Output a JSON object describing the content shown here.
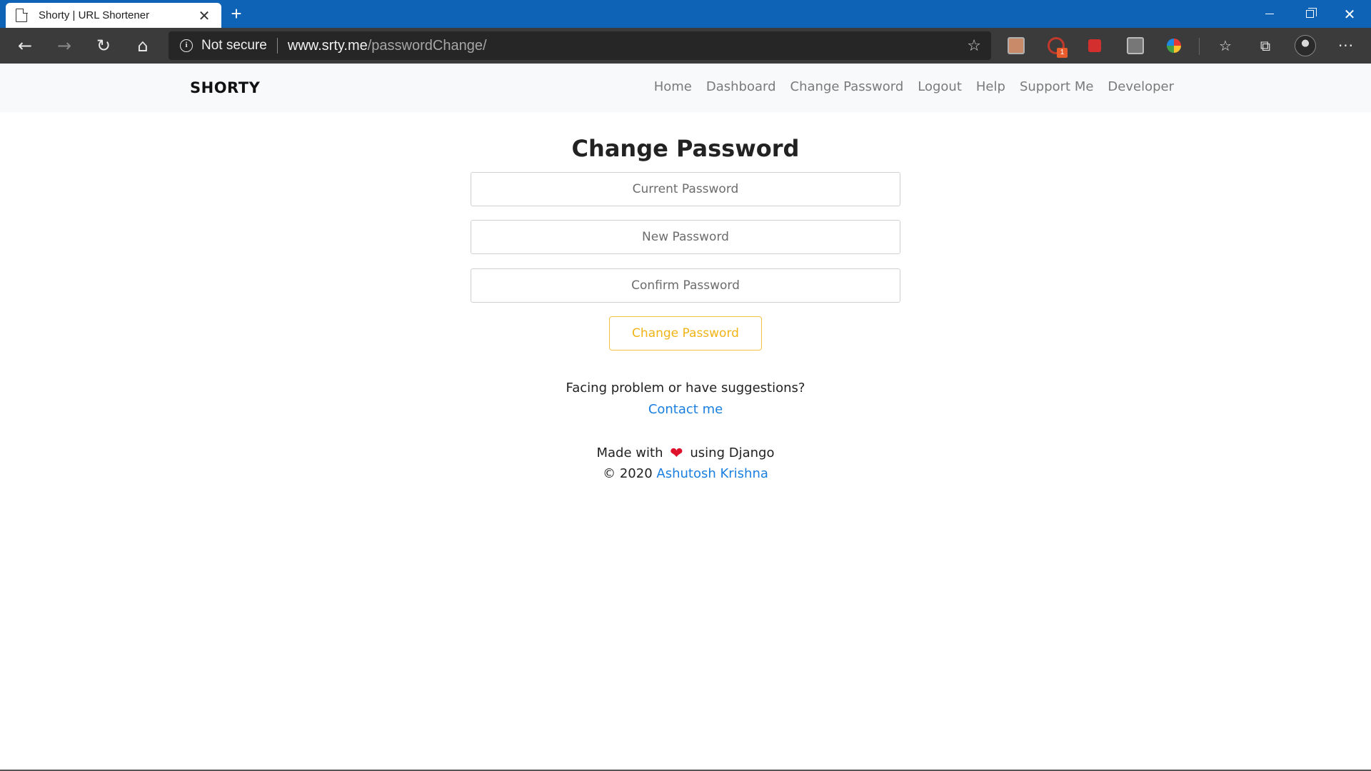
{
  "browser": {
    "tab_title": "Shorty | URL Shortener",
    "tab_close": "✕",
    "new_tab": "+",
    "security_label": "Not secure",
    "url_host": "www.srty.me",
    "url_path": "/passwordChange/",
    "ext_badge": "1"
  },
  "site": {
    "brand": "SHORTY",
    "nav": [
      "Home",
      "Dashboard",
      "Change Password",
      "Logout",
      "Help",
      "Support Me",
      "Developer"
    ]
  },
  "form": {
    "title": "Change Password",
    "current_placeholder": "Current Password",
    "new_placeholder": "New Password",
    "confirm_placeholder": "Confirm Password",
    "submit_label": "Change Password"
  },
  "footer": {
    "problem_text": "Facing problem or have suggestions?",
    "contact_label": "Contact me",
    "made_with_prefix": "Made with",
    "made_with_suffix": "using Django",
    "copyright_prefix": "© 2020",
    "author": "Ashutosh Krishna"
  },
  "colors": {
    "titlebar": "#0f63b6",
    "toolbar": "#3b3b3b",
    "link": "#1a7fe0",
    "warning": "#f0b416",
    "heart": "#e0112b"
  }
}
